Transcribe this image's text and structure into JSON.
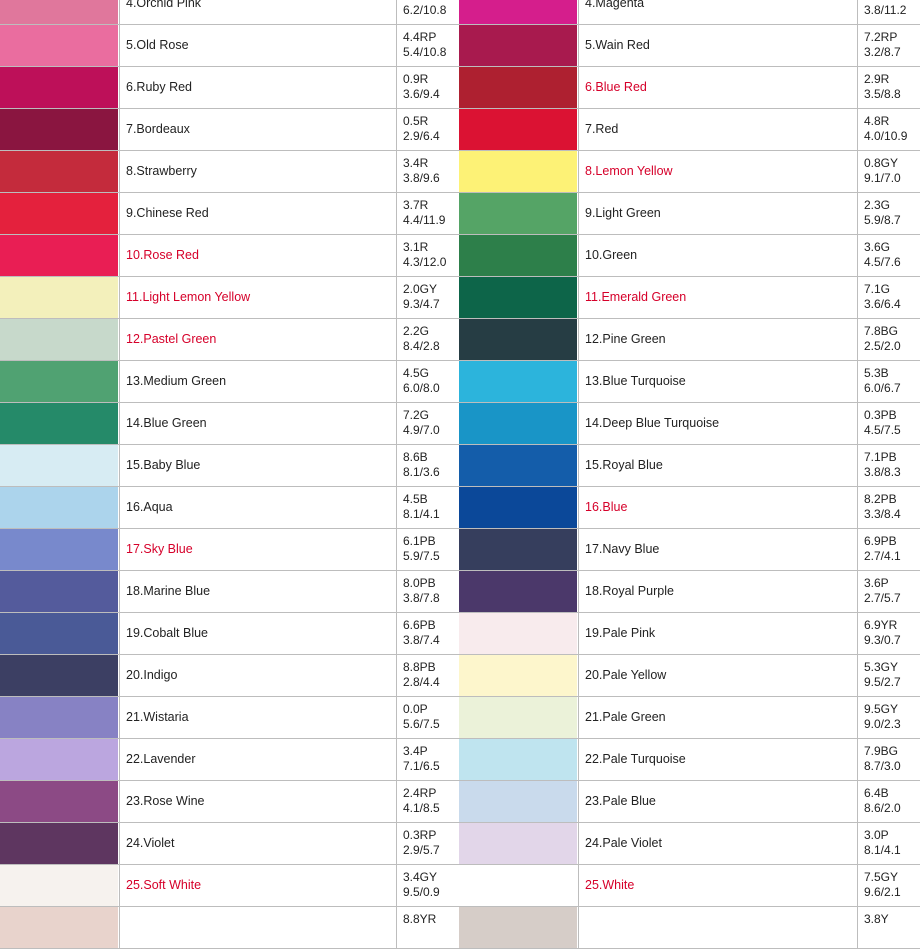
{
  "left": [
    {
      "name": "4.Orchid Pink",
      "hue": "",
      "value": "6.2/10.8",
      "color": "#e0779c",
      "highlight": false
    },
    {
      "name": "5.Old Rose",
      "hue": "4.4RP",
      "value": "5.4/10.8",
      "color": "#ea6d9f",
      "highlight": false
    },
    {
      "name": "6.Ruby Red",
      "hue": "0.9R",
      "value": "3.6/9.4",
      "color": "#bd1059",
      "highlight": false
    },
    {
      "name": "7.Bordeaux",
      "hue": "0.5R",
      "value": "2.9/6.4",
      "color": "#8a1540",
      "highlight": false
    },
    {
      "name": "8.Strawberry",
      "hue": "3.4R",
      "value": "3.8/9.6",
      "color": "#c42b3c",
      "highlight": false
    },
    {
      "name": "9.Chinese Red",
      "hue": "3.7R",
      "value": "4.4/11.9",
      "color": "#e4213d",
      "highlight": false
    },
    {
      "name": "10.Rose Red",
      "hue": "3.1R",
      "value": "4.3/12.0",
      "color": "#e91e54",
      "highlight": true
    },
    {
      "name": "11.Light Lemon Yellow",
      "hue": "2.0GY",
      "value": "9.3/4.7",
      "color": "#f3f0bb",
      "highlight": true
    },
    {
      "name": "12.Pastel Green",
      "hue": "2.2G",
      "value": "8.4/2.8",
      "color": "#c7d9cb",
      "highlight": true
    },
    {
      "name": "13.Medium Green",
      "hue": "4.5G",
      "value": "6.0/8.0",
      "color": "#50a272",
      "highlight": false
    },
    {
      "name": "14.Blue Green",
      "hue": "7.2G",
      "value": "4.9/7.0",
      "color": "#258a69",
      "highlight": false
    },
    {
      "name": "15.Baby Blue",
      "hue": "8.6B",
      "value": "8.1/3.6",
      "color": "#d7ecf3",
      "highlight": false
    },
    {
      "name": "16.Aqua",
      "hue": "4.5B",
      "value": "8.1/4.1",
      "color": "#acd4ec",
      "highlight": false
    },
    {
      "name": "17.Sky Blue",
      "hue": "6.1PB",
      "value": "5.9/7.5",
      "color": "#7889cc",
      "highlight": true
    },
    {
      "name": "18.Marine Blue",
      "hue": "8.0PB",
      "value": "3.8/7.8",
      "color": "#545b9c",
      "highlight": false
    },
    {
      "name": "19.Cobalt Blue",
      "hue": "6.6PB",
      "value": "3.8/7.4",
      "color": "#4a5a97",
      "highlight": false
    },
    {
      "name": "20.Indigo",
      "hue": "8.8PB",
      "value": "2.8/4.4",
      "color": "#3c3f63",
      "highlight": false
    },
    {
      "name": "21.Wistaria",
      "hue": "0.0P",
      "value": "5.6/7.5",
      "color": "#8782c4",
      "highlight": false
    },
    {
      "name": "22.Lavender",
      "hue": "3.4P",
      "value": "7.1/6.5",
      "color": "#bba6df",
      "highlight": false
    },
    {
      "name": "23.Rose Wine",
      "hue": "2.4RP",
      "value": "4.1/8.5",
      "color": "#8c4a85",
      "highlight": false
    },
    {
      "name": "24.Violet",
      "hue": "0.3RP",
      "value": "2.9/5.7",
      "color": "#5e3660",
      "highlight": false
    },
    {
      "name": "25.Soft White",
      "hue": "3.4GY",
      "value": "9.5/0.9",
      "color": "#f6f2ee",
      "highlight": true
    },
    {
      "name": "",
      "hue": "8.8YR",
      "value": "",
      "color": "#e8d3cc",
      "highlight": false
    }
  ],
  "right": [
    {
      "name": "4.Magenta",
      "hue": "",
      "value": "3.8/11.2",
      "color": "#d51e8c",
      "highlight": false
    },
    {
      "name": "5.Wain Red",
      "hue": "7.2RP",
      "value": "3.2/8.7",
      "color": "#a81a4e",
      "highlight": false
    },
    {
      "name": "6.Blue Red",
      "hue": "2.9R",
      "value": "3.5/8.8",
      "color": "#ae2030",
      "highlight": true
    },
    {
      "name": "7.Red",
      "hue": "4.8R",
      "value": "4.0/10.9",
      "color": "#db1233",
      "highlight": false
    },
    {
      "name": "8.Lemon Yellow",
      "hue": "0.8GY",
      "value": "9.1/7.0",
      "color": "#fdf276",
      "highlight": true
    },
    {
      "name": "9.Light Green",
      "hue": "2.3G",
      "value": "5.9/8.7",
      "color": "#55a466",
      "highlight": false
    },
    {
      "name": "10.Green",
      "hue": "3.6G",
      "value": "4.5/7.6",
      "color": "#2d7f4a",
      "highlight": false
    },
    {
      "name": "11.Emerald Green",
      "hue": "7.1G",
      "value": "3.6/6.4",
      "color": "#0d6549",
      "highlight": true
    },
    {
      "name": "12.Pine Green",
      "hue": "7.8BG",
      "value": "2.5/2.0",
      "color": "#263d44",
      "highlight": false
    },
    {
      "name": "13.Blue Turquoise",
      "hue": "5.3B",
      "value": "6.0/6.7",
      "color": "#2cb4dc",
      "highlight": false
    },
    {
      "name": "14.Deep Blue Turquoise",
      "hue": "0.3PB",
      "value": "4.5/7.5",
      "color": "#1995c7",
      "highlight": false
    },
    {
      "name": "15.Royal Blue",
      "hue": "7.1PB",
      "value": "3.8/8.3",
      "color": "#145daa",
      "highlight": false
    },
    {
      "name": "16.Blue",
      "hue": "8.2PB",
      "value": "3.3/8.4",
      "color": "#0b4899",
      "highlight": true
    },
    {
      "name": "17.Navy Blue",
      "hue": "6.9PB",
      "value": "2.7/4.1",
      "color": "#363e5d",
      "highlight": false
    },
    {
      "name": "18.Royal Purple",
      "hue": "3.6P",
      "value": "2.7/5.7",
      "color": "#4b386a",
      "highlight": false
    },
    {
      "name": "19.Pale Pink",
      "hue": "6.9YR",
      "value": "9.3/0.7",
      "color": "#f8ebed",
      "highlight": false
    },
    {
      "name": "20.Pale Yellow",
      "hue": "5.3GY",
      "value": "9.5/2.7",
      "color": "#fdf6cc",
      "highlight": false
    },
    {
      "name": "21.Pale Green",
      "hue": "9.5GY",
      "value": "9.0/2.3",
      "color": "#ebf2d9",
      "highlight": false
    },
    {
      "name": "22.Pale Turquoise",
      "hue": "7.9BG",
      "value": "8.7/3.0",
      "color": "#bfe4ef",
      "highlight": false
    },
    {
      "name": "23.Pale Blue",
      "hue": "6.4B",
      "value": "8.6/2.0",
      "color": "#c9daec",
      "highlight": false
    },
    {
      "name": "24.Pale Violet",
      "hue": "3.0P",
      "value": "8.1/4.1",
      "color": "#e2d6e9",
      "highlight": false
    },
    {
      "name": "25.White",
      "hue": "7.5GY",
      "value": "9.6/2.1",
      "color": "#ffffff",
      "highlight": true
    },
    {
      "name": "",
      "hue": "3.8Y",
      "value": "",
      "color": "#d6cdc8",
      "highlight": false
    }
  ]
}
